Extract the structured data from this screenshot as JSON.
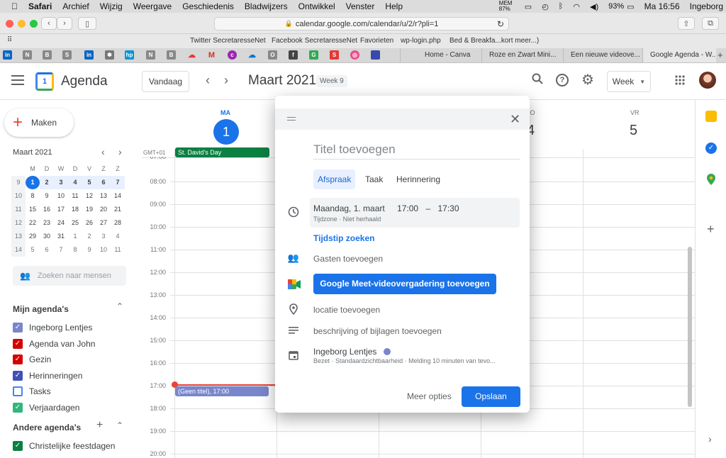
{
  "macos": {
    "menu": [
      "Safari",
      "Archief",
      "Wijzig",
      "Weergave",
      "Geschiedenis",
      "Bladwijzers",
      "Ontwikkel",
      "Venster",
      "Help"
    ],
    "mem": "MEM 87%",
    "battery": "93%",
    "clock": "Ma 16:56",
    "user": "Ingeborg"
  },
  "browser": {
    "url": "calendar.google.com/calendar/u/2/r?pli=1",
    "favorites": [
      "Twitter SecretaresseNet",
      "Facebook SecretaresseNet",
      "Favorieten",
      "wp-login.php",
      "Bed & Breakfa...kort meer...)"
    ],
    "tabs": [
      "Home - Canva",
      "Roze en Zwart Mini...",
      "Een nieuwe videove...",
      "Google Agenda - W..."
    ]
  },
  "header": {
    "app_name": "Agenda",
    "today_button": "Vandaag",
    "month": "Maart 2021",
    "week_badge": "Week 9",
    "view_select": "Week"
  },
  "sidebar": {
    "create_label": "Maken",
    "mini_month": "Maart 2021",
    "weekdays": [
      "M",
      "D",
      "W",
      "D",
      "V",
      "Z",
      "Z"
    ],
    "weeks": [
      {
        "wk": "9",
        "days": [
          "1",
          "2",
          "3",
          "4",
          "5",
          "6",
          "7"
        ]
      },
      {
        "wk": "10",
        "days": [
          "8",
          "9",
          "10",
          "11",
          "12",
          "13",
          "14"
        ]
      },
      {
        "wk": "11",
        "days": [
          "15",
          "16",
          "17",
          "18",
          "19",
          "20",
          "21"
        ]
      },
      {
        "wk": "12",
        "days": [
          "22",
          "23",
          "24",
          "25",
          "26",
          "27",
          "28"
        ]
      },
      {
        "wk": "13",
        "days": [
          "29",
          "30",
          "31",
          "1",
          "2",
          "3",
          "4"
        ]
      },
      {
        "wk": "14",
        "days": [
          "5",
          "6",
          "7",
          "8",
          "9",
          "10",
          "11"
        ]
      }
    ],
    "search_people": "Zoeken naar mensen",
    "my_calendars_title": "Mijn agenda's",
    "my_calendars": [
      {
        "label": "Ingeborg Lentjes",
        "color": "#7986cb",
        "checked": true
      },
      {
        "label": "Agenda van John",
        "color": "#d50000",
        "checked": true
      },
      {
        "label": "Gezin",
        "color": "#d50000",
        "checked": true
      },
      {
        "label": "Herinneringen",
        "color": "#3f51b5",
        "checked": true
      },
      {
        "label": "Tasks",
        "color": "#4285f4",
        "checked": false
      },
      {
        "label": "Verjaardagen",
        "color": "#33b679",
        "checked": true
      }
    ],
    "other_calendars_title": "Andere agenda's",
    "other_calendars": [
      {
        "label": "Christelijke feestdagen",
        "color": "#0b8043",
        "checked": true
      }
    ]
  },
  "grid": {
    "day1_name": "MA",
    "day1_num": "1",
    "day_partial": "DO",
    "day_partial_num": "4",
    "day5_name": "VR",
    "day5_num": "5",
    "timezone": "GMT+01",
    "allday_event": "St. David's Day",
    "hours": [
      "08:00",
      "09:00",
      "10:00",
      "11:00",
      "12:00",
      "13:00",
      "14:00",
      "15:00",
      "16:00",
      "17:00",
      "18:00",
      "19:00",
      "20:00"
    ],
    "hour_partial_top": "07:00",
    "draft_event": "(Geen titel), 17:00"
  },
  "modal": {
    "title_placeholder": "Titel toevoegen",
    "types": [
      "Afspraak",
      "Taak",
      "Herinnering"
    ],
    "date": "Maandag, 1. maart",
    "start": "17:00",
    "dash": "–",
    "end": "17:30",
    "tz_repeat": "Tijdzone · Niet herhaald",
    "find_time": "Tijdstip zoeken",
    "guests": "Gasten toevoegen",
    "meet_button": "Google Meet-videovergadering toevoegen",
    "location": "locatie toevoegen",
    "description": "beschrijving of bijlagen toevoegen",
    "calendar_owner": "Ingeborg Lentjes",
    "calendar_details": "Bezet · Standaardzichtbaarheid · Melding 10 minuten van tevo...",
    "more_options": "Meer opties",
    "save": "Opslaan"
  }
}
